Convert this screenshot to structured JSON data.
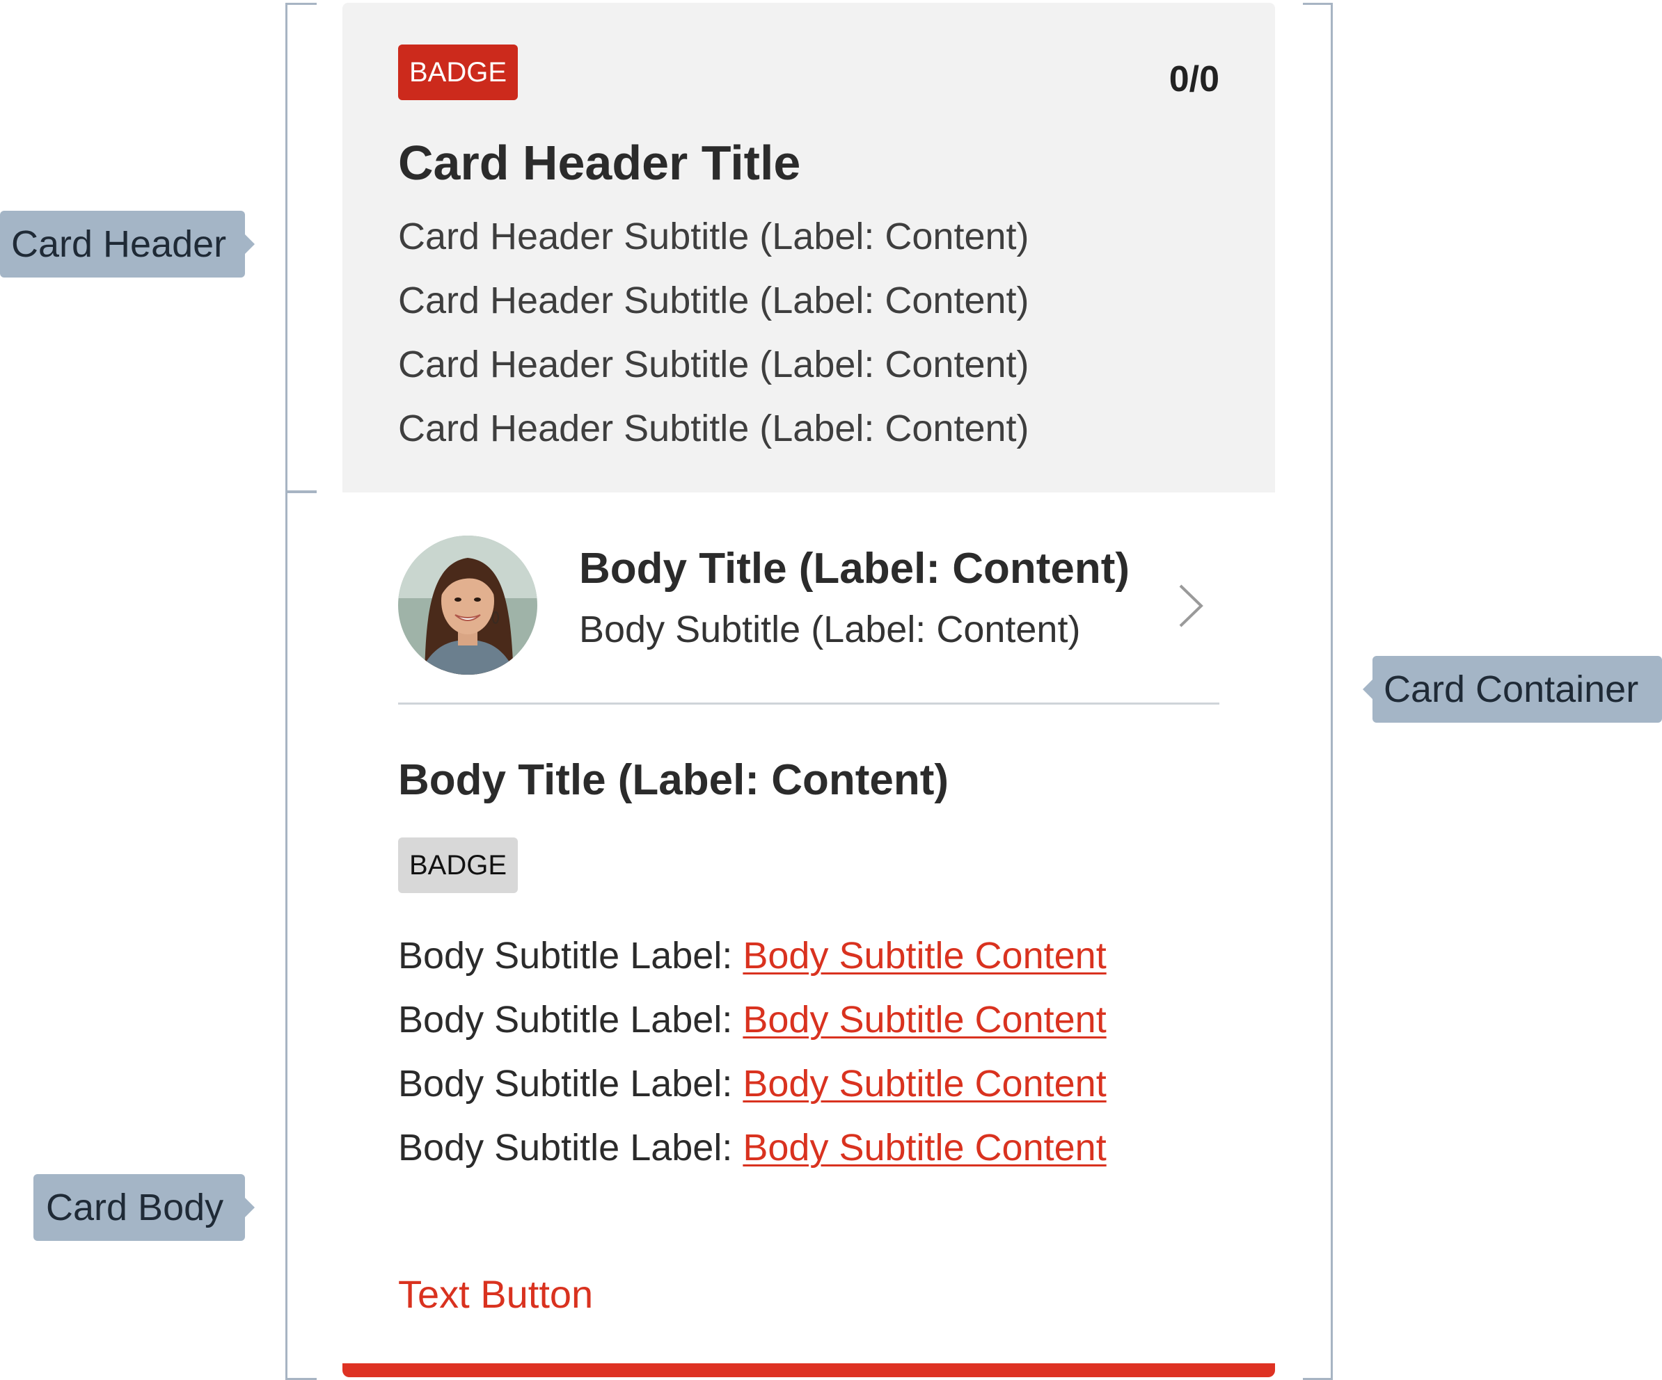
{
  "annotations": {
    "card_header": "Card Header",
    "card_body": "Card Body",
    "card_container": "Card Container"
  },
  "card": {
    "header": {
      "badge": "BADGE",
      "counter": "0/0",
      "title": "Card Header Title",
      "subtitles": [
        "Card Header Subtitle (Label: Content)",
        "Card Header Subtitle (Label: Content)",
        "Card Header Subtitle (Label: Content)",
        "Card Header Subtitle (Label: Content)"
      ]
    },
    "body": {
      "item": {
        "title": "Body Title (Label: Content)",
        "subtitle": "Body Subtitle (Label: Content)",
        "avatar_icon": "person-avatar",
        "chevron_icon": "chevron-right-icon"
      },
      "section_title": "Body Title (Label: Content)",
      "badge": "BADGE",
      "rows": [
        {
          "label": "Body Subtitle Label:",
          "link": "Body Subtitle Content"
        },
        {
          "label": "Body Subtitle Label:",
          "link": "Body Subtitle Content"
        },
        {
          "label": "Body Subtitle Label:",
          "link": "Body Subtitle Content"
        },
        {
          "label": "Body Subtitle Label:",
          "link": "Body Subtitle Content"
        }
      ],
      "text_button": "Text Button"
    }
  },
  "colors": {
    "accent": "#d9321f",
    "header_bg": "#f2f2f2",
    "badge_red": "#cc2a1c",
    "badge_gray": "#d8d8d8",
    "guide": "#a4b5c6"
  }
}
